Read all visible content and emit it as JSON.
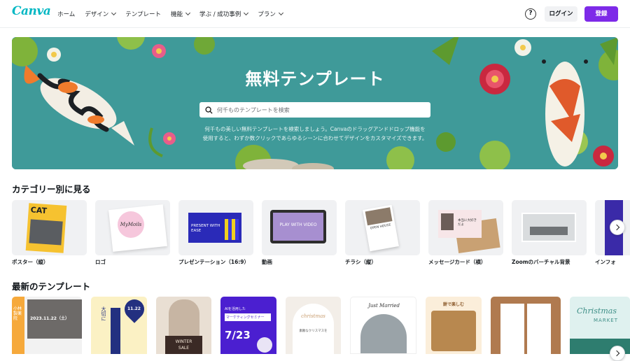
{
  "nav": {
    "logo": "Canva",
    "items": [
      {
        "label": "ホーム",
        "dropdown": false
      },
      {
        "label": "デザイン",
        "dropdown": true
      },
      {
        "label": "テンプレート",
        "dropdown": false
      },
      {
        "label": "機能",
        "dropdown": true
      },
      {
        "label": "学ぶ / 成功事例",
        "dropdown": true
      },
      {
        "label": "プラン",
        "dropdown": true
      }
    ],
    "help_icon": "?",
    "login": "ログイン",
    "signup": "登録"
  },
  "hero": {
    "title": "無料テンプレート",
    "search_placeholder": "何千ものテンプレートを検索",
    "desc_line1": "何千もの美しい無料テンプレートを検索しましょう。Canvaのドラッグアンドドロップ機能を",
    "desc_line2": "使用すると、わずか数クリックであらゆるシーンに合わせてデザインをカスタマイズできます。"
  },
  "categories": {
    "title": "カテゴリー別に見る",
    "items": [
      {
        "label": "ポスター（縦）",
        "thumb_text": "CAT"
      },
      {
        "label": "ロゴ",
        "thumb_text": "MyMoils"
      },
      {
        "label": "プレゼンテーション（16:9）",
        "thumb_text": "PRESENT WITH EASE"
      },
      {
        "label": "動画",
        "thumb_text": "PLAY WITH VIDEO"
      },
      {
        "label": "チラシ（縦）",
        "thumb_text": "OPEN HOUSE"
      },
      {
        "label": "メッセージカード（横）",
        "thumb_text": "本当に大好きだよ"
      },
      {
        "label": "Zoomのバーチャル背景",
        "thumb_text": ""
      },
      {
        "label": "インフォ",
        "thumb_text": ""
      }
    ]
  },
  "latest": {
    "title": "最新のテンプレート",
    "items": [
      {
        "text1": "小林製薬院",
        "text2": "2023.11.22（土）"
      },
      {
        "text1": "大切に",
        "text2": "11.22"
      },
      {
        "text1": "WINTER",
        "text2": "SALE"
      },
      {
        "text1": "AIを活用した",
        "text2": "マーケティングセミナー",
        "text3": "7/23"
      },
      {
        "text1": "christmas",
        "text2": "素敵なクリスマスを"
      },
      {
        "text1": "Just Married",
        "text2": ""
      },
      {
        "text1": "餅で楽しむ",
        "text2": ""
      },
      {
        "text1": "",
        "text2": ""
      },
      {
        "text1": "Christmas",
        "text2": "MARKET"
      }
    ]
  },
  "colors": {
    "brand": "#7d2ae8",
    "logo": "#00b7c3",
    "hero_bg": "#3f9a99"
  }
}
